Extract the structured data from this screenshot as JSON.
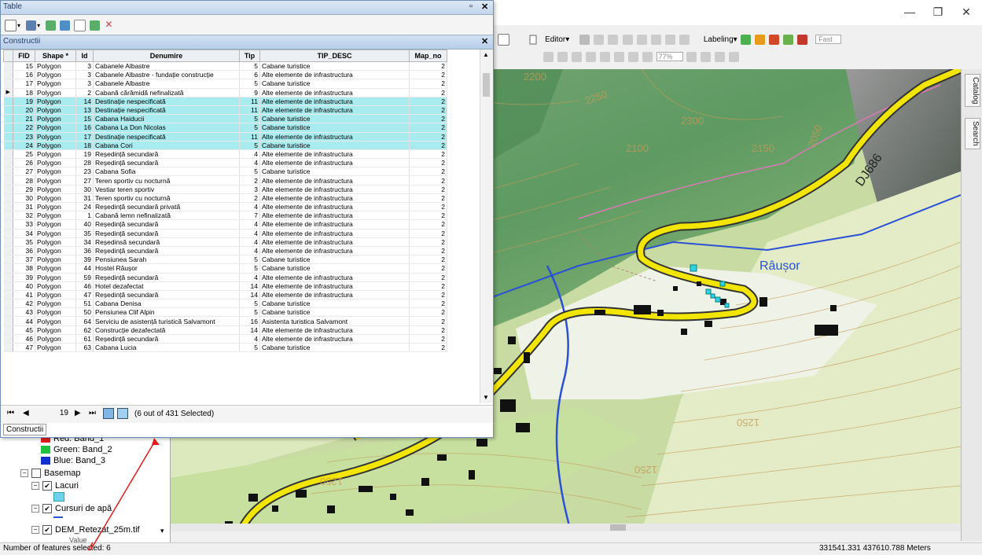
{
  "window": {
    "minimize": "—",
    "maximize": "❐",
    "close": "✕"
  },
  "toolbar": {
    "editor_label": "Editor▾",
    "labeling_label": "Labeling▾",
    "fast_label": "Fast",
    "scale_label": "77%"
  },
  "table_window": {
    "title": "Table",
    "layer_tab": "Constructii",
    "columns": [
      "",
      "FID",
      "Shape *",
      "Id",
      "Denumire",
      "Tip",
      "TIP_DESC",
      "Map_no"
    ],
    "rows": [
      {
        "fid": "15",
        "shape": "Polygon",
        "id": "3",
        "den": "Cabanele Albastre",
        "tip": "5",
        "desc": "Cabane turistice",
        "map": "2",
        "sel": false,
        "cur": false
      },
      {
        "fid": "16",
        "shape": "Polygon",
        "id": "3",
        "den": "Cabanele Albastre - fundație construcție",
        "tip": "6",
        "desc": "Alte elemente de infrastructura",
        "map": "2",
        "sel": false,
        "cur": false
      },
      {
        "fid": "17",
        "shape": "Polygon",
        "id": "3",
        "den": "Cabanele Albastre",
        "tip": "5",
        "desc": "Cabane turistice",
        "map": "2",
        "sel": false,
        "cur": false
      },
      {
        "fid": "18",
        "shape": "Polygon",
        "id": "2",
        "den": "Cabană cărămidă nefinalizată",
        "tip": "9",
        "desc": "Alte elemente de infrastructura",
        "map": "2",
        "sel": false,
        "cur": true
      },
      {
        "fid": "19",
        "shape": "Polygon",
        "id": "14",
        "den": "Destinație nespecificată",
        "tip": "11",
        "desc": "Alte elemente de infrastructura",
        "map": "2",
        "sel": true,
        "cur": false
      },
      {
        "fid": "20",
        "shape": "Polygon",
        "id": "13",
        "den": "Destinație nespecificată",
        "tip": "11",
        "desc": "Alte elemente de infrastructura",
        "map": "2",
        "sel": true,
        "cur": false
      },
      {
        "fid": "21",
        "shape": "Polygon",
        "id": "15",
        "den": "Cabana Haiducii",
        "tip": "5",
        "desc": "Cabane turistice",
        "map": "2",
        "sel": true,
        "cur": false
      },
      {
        "fid": "22",
        "shape": "Polygon",
        "id": "16",
        "den": "Cabana La Don Nicolas",
        "tip": "5",
        "desc": "Cabane turistice",
        "map": "2",
        "sel": true,
        "cur": false
      },
      {
        "fid": "23",
        "shape": "Polygon",
        "id": "17",
        "den": "Destinație nespecificată",
        "tip": "11",
        "desc": "Alte elemente de infrastructura",
        "map": "2",
        "sel": true,
        "cur": false
      },
      {
        "fid": "24",
        "shape": "Polygon",
        "id": "18",
        "den": "Cabana Cori",
        "tip": "5",
        "desc": "Cabane turistice",
        "map": "2",
        "sel": true,
        "cur": false
      },
      {
        "fid": "25",
        "shape": "Polygon",
        "id": "19",
        "den": "Reședință secundară",
        "tip": "4",
        "desc": "Alte elemente de infrastructura",
        "map": "2",
        "sel": false,
        "cur": false
      },
      {
        "fid": "26",
        "shape": "Polygon",
        "id": "28",
        "den": "Reședință secundară",
        "tip": "4",
        "desc": "Alte elemente de infrastructura",
        "map": "2",
        "sel": false,
        "cur": false
      },
      {
        "fid": "27",
        "shape": "Polygon",
        "id": "23",
        "den": "Cabana Sofia",
        "tip": "5",
        "desc": "Cabane turistice",
        "map": "2",
        "sel": false,
        "cur": false
      },
      {
        "fid": "28",
        "shape": "Polygon",
        "id": "27",
        "den": "Teren sportiv cu nocturnă",
        "tip": "2",
        "desc": "Alte elemente de infrastructura",
        "map": "2",
        "sel": false,
        "cur": false
      },
      {
        "fid": "29",
        "shape": "Polygon",
        "id": "30",
        "den": "Vestiar teren sportiv",
        "tip": "3",
        "desc": "Alte elemente de infrastructura",
        "map": "2",
        "sel": false,
        "cur": false
      },
      {
        "fid": "30",
        "shape": "Polygon",
        "id": "31",
        "den": "Teren sportiv cu nocturnă",
        "tip": "2",
        "desc": "Alte elemente de infrastructura",
        "map": "2",
        "sel": false,
        "cur": false
      },
      {
        "fid": "31",
        "shape": "Polygon",
        "id": "24",
        "den": "Reședință secundară privată",
        "tip": "4",
        "desc": "Alte elemente de infrastructura",
        "map": "2",
        "sel": false,
        "cur": false
      },
      {
        "fid": "32",
        "shape": "Polygon",
        "id": "1",
        "den": "Cabană lemn nefinalizată",
        "tip": "7",
        "desc": "Alte elemente de infrastructura",
        "map": "2",
        "sel": false,
        "cur": false
      },
      {
        "fid": "33",
        "shape": "Polygon",
        "id": "40",
        "den": "Reședință secundară",
        "tip": "4",
        "desc": "Alte elemente de infrastructura",
        "map": "2",
        "sel": false,
        "cur": false
      },
      {
        "fid": "34",
        "shape": "Polygon",
        "id": "35",
        "den": "Reședință secundară",
        "tip": "4",
        "desc": "Alte elemente de infrastructura",
        "map": "2",
        "sel": false,
        "cur": false
      },
      {
        "fid": "35",
        "shape": "Polygon",
        "id": "34",
        "den": "Reședinsă secundară",
        "tip": "4",
        "desc": "Alte elemente de infrastructura",
        "map": "2",
        "sel": false,
        "cur": false
      },
      {
        "fid": "36",
        "shape": "Polygon",
        "id": "36",
        "den": "Reședință secundară",
        "tip": "4",
        "desc": "Alte elemente de infrastructura",
        "map": "2",
        "sel": false,
        "cur": false
      },
      {
        "fid": "37",
        "shape": "Polygon",
        "id": "39",
        "den": "Pensiunea Sarah",
        "tip": "5",
        "desc": "Cabane turistice",
        "map": "2",
        "sel": false,
        "cur": false
      },
      {
        "fid": "38",
        "shape": "Polygon",
        "id": "44",
        "den": "Hostel Râușor",
        "tip": "5",
        "desc": "Cabane turistice",
        "map": "2",
        "sel": false,
        "cur": false
      },
      {
        "fid": "39",
        "shape": "Polygon",
        "id": "59",
        "den": "Reședință secundară",
        "tip": "4",
        "desc": "Alte elemente de infrastructura",
        "map": "2",
        "sel": false,
        "cur": false
      },
      {
        "fid": "40",
        "shape": "Polygon",
        "id": "46",
        "den": "Hotel dezafectat",
        "tip": "14",
        "desc": "Alte elemente de infrastructura",
        "map": "2",
        "sel": false,
        "cur": false
      },
      {
        "fid": "41",
        "shape": "Polygon",
        "id": "47",
        "den": "Reședință secundară",
        "tip": "14",
        "desc": "Alte elemente de infrastructura",
        "map": "2",
        "sel": false,
        "cur": false
      },
      {
        "fid": "42",
        "shape": "Polygon",
        "id": "51",
        "den": "Cabana Denisa",
        "tip": "5",
        "desc": "Cabane turistice",
        "map": "2",
        "sel": false,
        "cur": false
      },
      {
        "fid": "43",
        "shape": "Polygon",
        "id": "50",
        "den": "Pensiunea Clif Alpin",
        "tip": "5",
        "desc": "Cabane turistice",
        "map": "2",
        "sel": false,
        "cur": false
      },
      {
        "fid": "44",
        "shape": "Polygon",
        "id": "64",
        "den": "Serviciu de asistență turistică Salvamont",
        "tip": "16",
        "desc": "Asistenta turistica Salvamont",
        "map": "2",
        "sel": false,
        "cur": false
      },
      {
        "fid": "45",
        "shape": "Polygon",
        "id": "62",
        "den": "Construcție dezafectată",
        "tip": "14",
        "desc": "Alte elemente de infrastructura",
        "map": "2",
        "sel": false,
        "cur": false
      },
      {
        "fid": "46",
        "shape": "Polygon",
        "id": "61",
        "den": "Reședință secundară",
        "tip": "4",
        "desc": "Alte elemente de infrastructura",
        "map": "2",
        "sel": false,
        "cur": false
      },
      {
        "fid": "47",
        "shape": "Polygon",
        "id": "63",
        "den": "Cabana Lucia",
        "tip": "5",
        "desc": "Cabane turistice",
        "map": "2",
        "sel": false,
        "cur": false
      }
    ],
    "nav": {
      "current_record": "19",
      "selection_info": "(6 out of 431 Selected)"
    },
    "bottom_tab": "Constructii"
  },
  "toc": {
    "items": [
      {
        "label": "Red:   Band_1",
        "color": "#e02020"
      },
      {
        "label": "Green: Band_2",
        "color": "#20c040"
      },
      {
        "label": "Blue:  Band_3",
        "color": "#1030d0"
      }
    ],
    "basemap": "Basemap",
    "lacuri": "Lacuri",
    "cursuri": "Cursuri de apă",
    "dem": "DEM_Retezat_25m.tif",
    "value": "Value"
  },
  "map_labels": {
    "river": "Râușor",
    "road": "DJ686",
    "contours": [
      "2200",
      "2250",
      "2300",
      "2100",
      "2150",
      "2050",
      "1250",
      "1250",
      "1250"
    ]
  },
  "right_dock": {
    "catalog": "Catalog",
    "search": "Search"
  },
  "status": {
    "features_selected": "Number of features selected: 6",
    "coordinates": "331541.331  437610.788 Meters"
  },
  "colors": {
    "selection": "#a9ecf0",
    "road": "#f2e600",
    "river": "#2a50d8"
  }
}
